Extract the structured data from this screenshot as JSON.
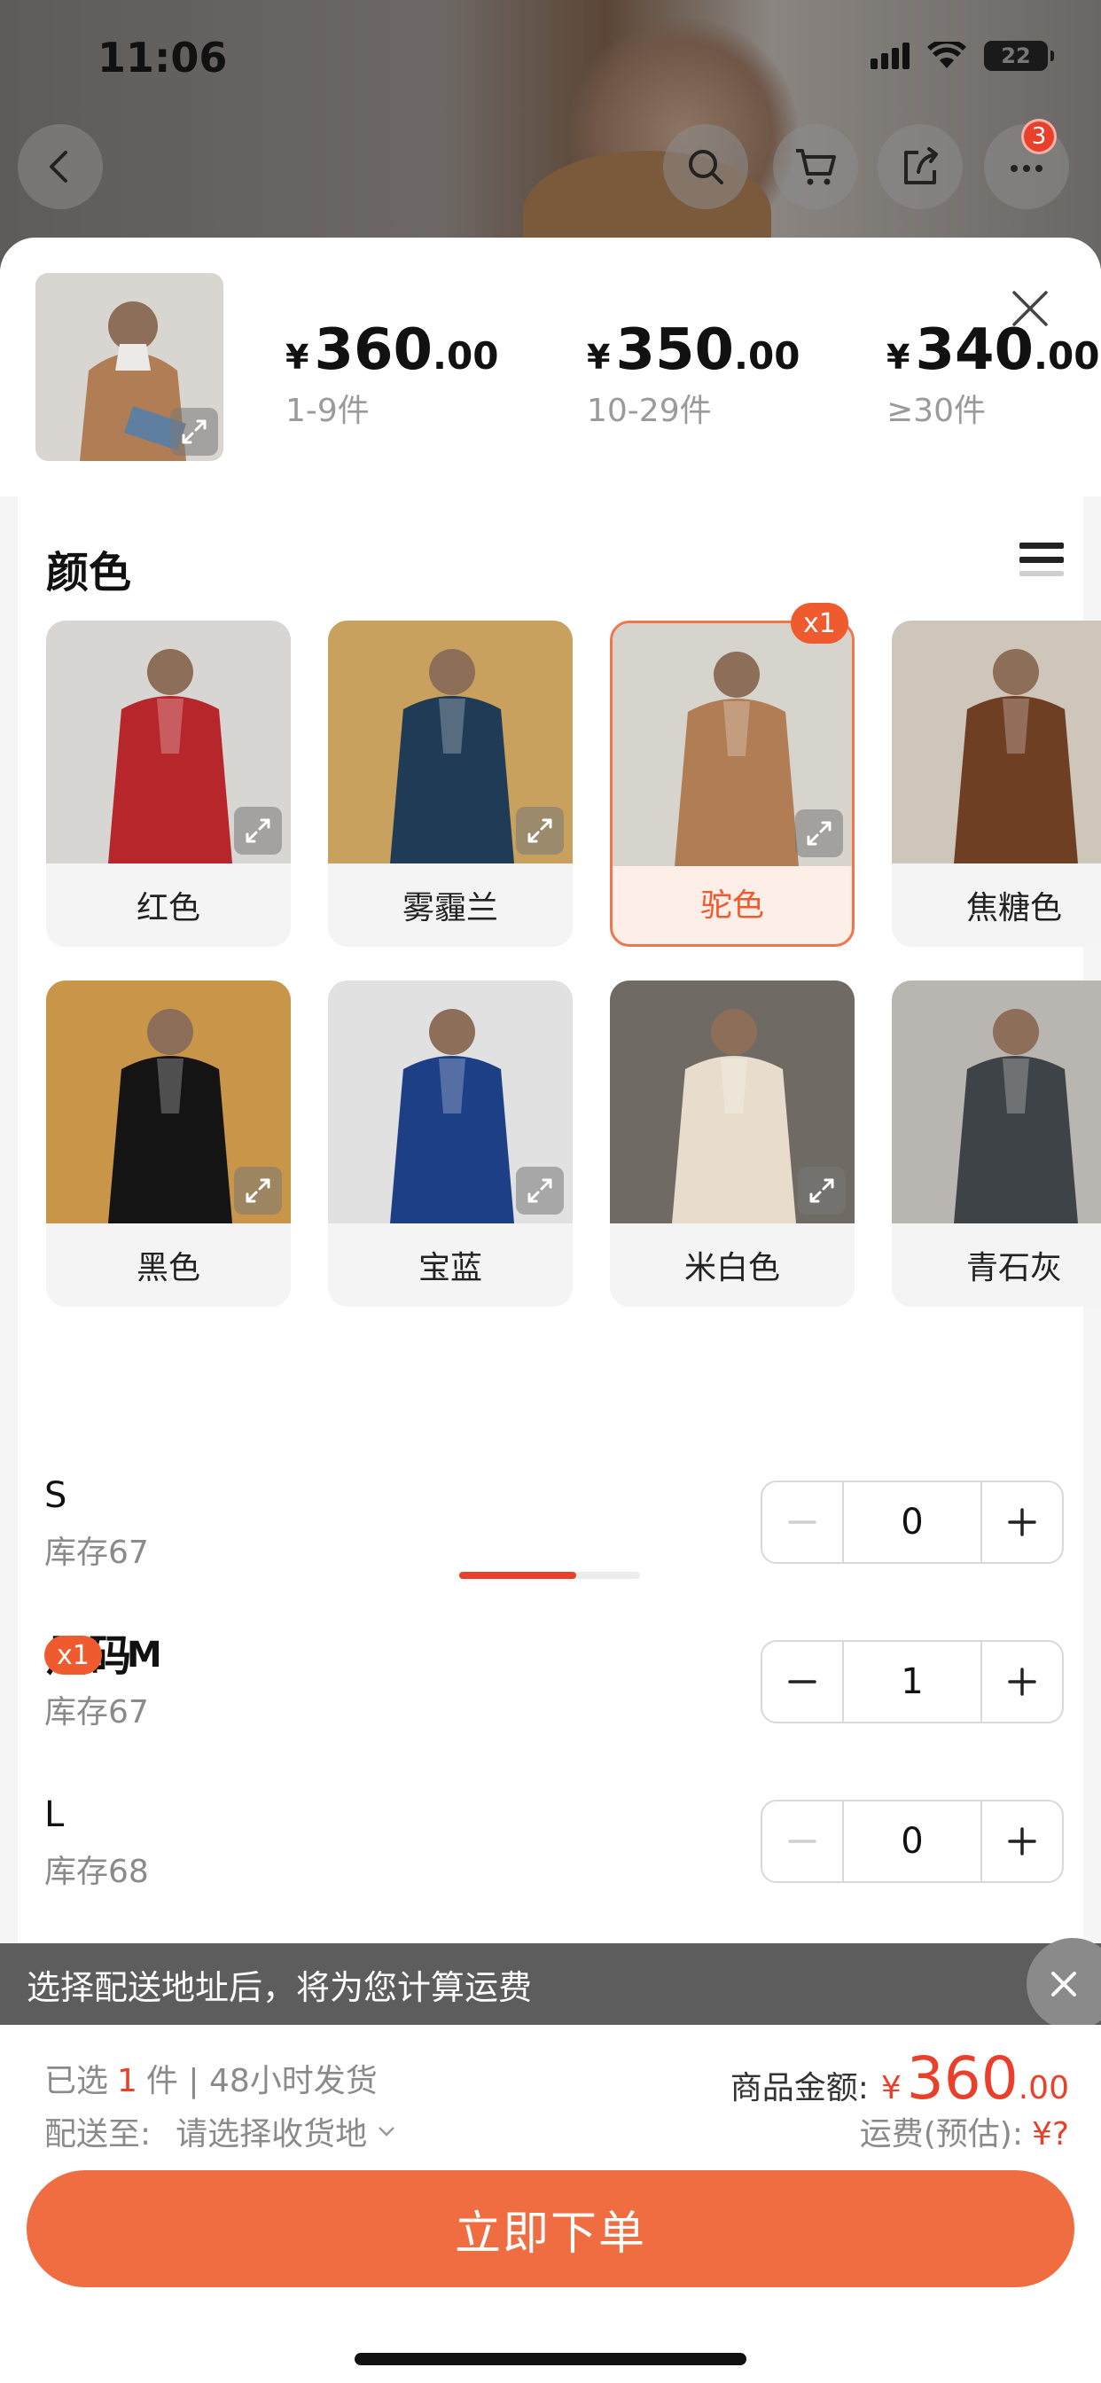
{
  "status_bar": {
    "time": "11:06",
    "battery": "22"
  },
  "nav": {
    "cart_badge": "3"
  },
  "price_tiers": [
    {
      "currency": "¥",
      "int": "360",
      "dec": ".00",
      "range": "1-9件"
    },
    {
      "currency": "¥",
      "int": "350",
      "dec": ".00",
      "range": "10-29件"
    },
    {
      "currency": "¥",
      "int": "340",
      "dec": ".00",
      "range": "≥30件"
    }
  ],
  "color_section": {
    "title": "颜色",
    "selected_badge": "x1",
    "options": [
      {
        "label": "红色",
        "tone": "#b7262b",
        "bg": "#d8d6d3"
      },
      {
        "label": "雾霾兰",
        "tone": "#1f3b55",
        "bg": "#c8a15e"
      },
      {
        "label": "驼色",
        "tone": "#b07d55",
        "bg": "#d7d3cd"
      },
      {
        "label": "焦糖色",
        "tone": "#6f3f24",
        "bg": "#cfc6bb"
      },
      {
        "label": "黑色",
        "tone": "#141414",
        "bg": "#c99548"
      },
      {
        "label": "宝蓝",
        "tone": "#1d3f86",
        "bg": "#e1e1e1"
      },
      {
        "label": "米白色",
        "tone": "#e8ddcc",
        "bg": "#6f6a64"
      },
      {
        "label": "青石灰",
        "tone": "#3e4347",
        "bg": "#b9b6b2"
      }
    ]
  },
  "size_section": {
    "title": "尺码",
    "sizes": [
      {
        "name": "S",
        "stock": "库存67",
        "qty": "0",
        "badge": ""
      },
      {
        "name": "M",
        "stock": "库存67",
        "qty": "1",
        "badge": "x1"
      },
      {
        "name": "L",
        "stock": "库存68",
        "qty": "0",
        "badge": ""
      }
    ]
  },
  "shipping_banner": {
    "text": "选择配送地址后，将为您计算运费"
  },
  "footer": {
    "selected_prefix": "已选",
    "selected_count": "1",
    "selected_suffix": "件 | 48小时发货",
    "ship_to_label": "配送至:",
    "ship_to_value": "请选择收货地",
    "total_label": "商品金额:",
    "total_currency": "¥",
    "total_int": "360",
    "total_dec": ".00",
    "fee_label": "运费(预估):",
    "fee_value": "¥?",
    "order_button": "立即下单"
  },
  "colors": {
    "accent": "#ef6d40",
    "red": "#e8402a"
  }
}
